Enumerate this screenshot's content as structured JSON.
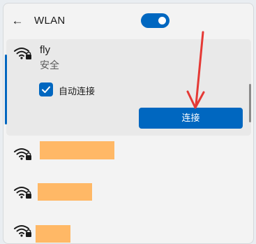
{
  "header": {
    "back_icon": "back-arrow-icon",
    "title": "WLAN",
    "wifi_enabled": true,
    "toggle_color": "#0067c0"
  },
  "networks": [
    {
      "ssid": "fly",
      "security": "安全",
      "icon": "wifi-secured-icon",
      "expanded": true,
      "auto_connect_label": "自动连接",
      "auto_connect": true,
      "connect_label": "连接"
    },
    {
      "ssid": "",
      "icon": "wifi-secured-icon",
      "redacted": true
    },
    {
      "ssid": "",
      "icon": "wifi-secured-icon",
      "redacted": true
    },
    {
      "ssid": "",
      "icon": "wifi-secured-icon",
      "redacted": true
    }
  ],
  "colors": {
    "accent": "#0067c0",
    "redaction": "#ffb866",
    "annotation_arrow": "#e53935"
  }
}
